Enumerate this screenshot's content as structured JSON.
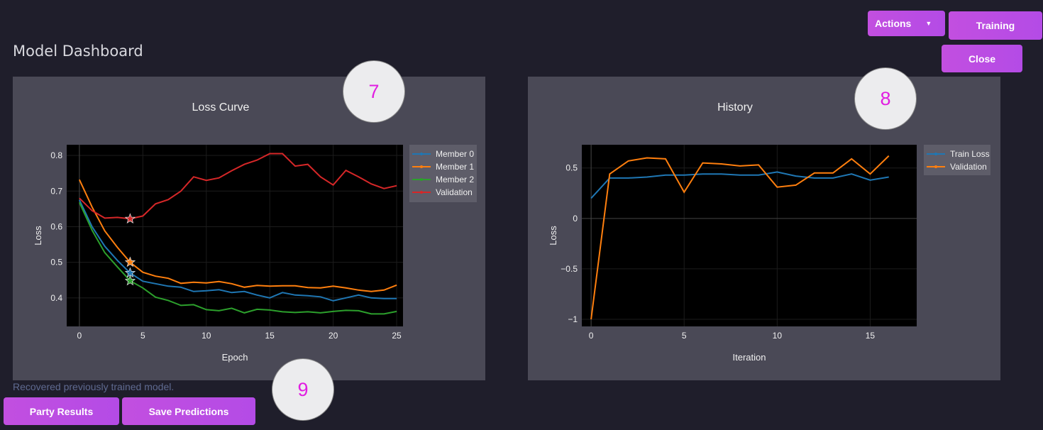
{
  "page": {
    "title": "Model Dashboard",
    "status": "Recovered previously trained model."
  },
  "buttons": {
    "actions": "Actions",
    "training": "Training",
    "close": "Close",
    "party_results": "Party Results",
    "save_predictions": "Save Predictions"
  },
  "markers": [
    "7",
    "8",
    "9"
  ],
  "colors": {
    "accent": "#c24fe0",
    "background": "#1f1e2b",
    "panel": "#4a4956",
    "marker_text": "#e11ee1"
  },
  "chart_data": [
    {
      "type": "line",
      "title": "Loss Curve",
      "xlabel": "Epoch",
      "ylabel": "Loss",
      "xlim": [
        -1,
        25.5
      ],
      "ylim": [
        0.32,
        0.83
      ],
      "xticks": [
        0,
        5,
        10,
        15,
        20,
        25
      ],
      "yticks": [
        0.4,
        0.5,
        0.6,
        0.7,
        0.8
      ],
      "legend": "top-right",
      "x": [
        0,
        1,
        2,
        3,
        4,
        5,
        6,
        7,
        8,
        9,
        10,
        11,
        12,
        13,
        14,
        15,
        16,
        17,
        18,
        19,
        20,
        21,
        22,
        23,
        24,
        25
      ],
      "series": [
        {
          "name": "Member 0",
          "color": "#1f77b4",
          "best_epoch": 4,
          "values": [
            0.675,
            0.6,
            0.545,
            0.505,
            0.47,
            0.447,
            0.44,
            0.433,
            0.43,
            0.418,
            0.42,
            0.423,
            0.415,
            0.418,
            0.408,
            0.4,
            0.415,
            0.408,
            0.406,
            0.403,
            0.392,
            0.4,
            0.408,
            0.4,
            0.398,
            0.398
          ]
        },
        {
          "name": "Member 1",
          "color": "#ff7f0e",
          "best_epoch": 4,
          "values": [
            0.732,
            0.655,
            0.588,
            0.542,
            0.5,
            0.472,
            0.461,
            0.455,
            0.441,
            0.444,
            0.442,
            0.446,
            0.44,
            0.43,
            0.435,
            0.433,
            0.434,
            0.434,
            0.429,
            0.428,
            0.433,
            0.428,
            0.422,
            0.418,
            0.422,
            0.436
          ]
        },
        {
          "name": "Member 2",
          "color": "#2ca02c",
          "best_epoch": 4,
          "values": [
            0.668,
            0.59,
            0.527,
            0.487,
            0.448,
            0.428,
            0.402,
            0.393,
            0.379,
            0.381,
            0.367,
            0.364,
            0.371,
            0.358,
            0.368,
            0.366,
            0.361,
            0.359,
            0.361,
            0.358,
            0.362,
            0.365,
            0.364,
            0.355,
            0.355,
            0.362
          ]
        },
        {
          "name": "Validation",
          "color": "#d62728",
          "best_epoch": 4,
          "values": [
            0.68,
            0.645,
            0.624,
            0.626,
            0.622,
            0.63,
            0.664,
            0.676,
            0.7,
            0.74,
            0.73,
            0.737,
            0.757,
            0.775,
            0.787,
            0.805,
            0.805,
            0.77,
            0.775,
            0.74,
            0.717,
            0.758,
            0.74,
            0.72,
            0.707,
            0.715
          ]
        }
      ]
    },
    {
      "type": "line",
      "title": "History",
      "xlabel": "Iteration",
      "ylabel": "Loss",
      "xlim": [
        -0.5,
        17.5
      ],
      "ylim": [
        -1.07,
        0.73
      ],
      "xticks": [
        0,
        5,
        10,
        15
      ],
      "yticks": [
        -1,
        -0.5,
        0,
        0.5
      ],
      "legend": "top-right",
      "x": [
        0,
        1,
        2,
        3,
        4,
        5,
        6,
        7,
        8,
        9,
        10,
        11,
        12,
        13,
        14,
        15,
        16
      ],
      "series": [
        {
          "name": "Train Loss",
          "color": "#1f77b4",
          "values": [
            0.2,
            0.4,
            0.4,
            0.41,
            0.43,
            0.43,
            0.44,
            0.44,
            0.43,
            0.43,
            0.46,
            0.42,
            0.4,
            0.4,
            0.44,
            0.38,
            0.41
          ]
        },
        {
          "name": "Validation",
          "color": "#ff7f0e",
          "values": [
            -1,
            0.44,
            0.57,
            0.6,
            0.59,
            0.26,
            0.55,
            0.54,
            0.52,
            0.53,
            0.31,
            0.33,
            0.45,
            0.45,
            0.59,
            0.44,
            0.62
          ]
        }
      ]
    }
  ]
}
